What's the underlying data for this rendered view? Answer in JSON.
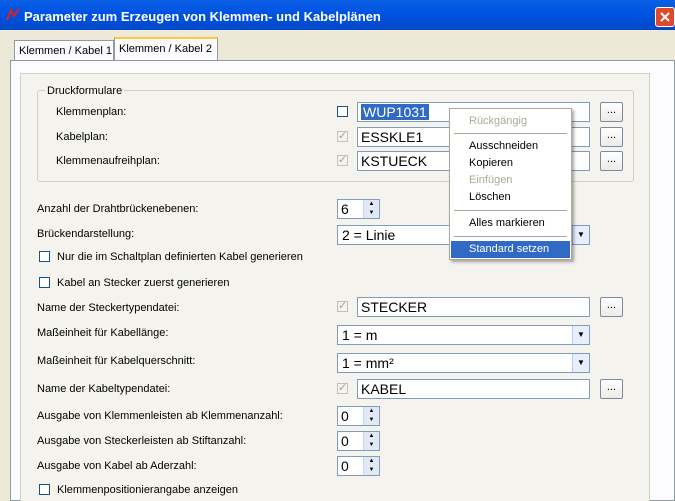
{
  "window": {
    "title": "Parameter zum Erzeugen von Klemmen- und Kabelplänen"
  },
  "tabs": [
    "Klemmen / Kabel 1",
    "Klemmen / Kabel 2"
  ],
  "group": {
    "title": "Druckformulare",
    "rows": [
      {
        "label": "Klemmenplan:",
        "value": "WUP1031",
        "checked": false
      },
      {
        "label": "Kabelplan:",
        "value": "ESSKLE1",
        "checked": true
      },
      {
        "label": "Klemmenaufreihplan:",
        "value": "KSTUECK",
        "checked": true
      }
    ]
  },
  "fields": {
    "drahtbrueckenebenen": {
      "label": "Anzahl der Drahtbrückenebenen:",
      "value": "6"
    },
    "brueckendarstellung": {
      "label": "Brückendarstellung:",
      "value": "2 = Linie"
    },
    "nur_schaltplan": "Nur die im Schaltplan definierten Kabel generieren",
    "kabel_stecker": "Kabel an Stecker zuerst generieren",
    "steckertypendatei": {
      "label": "Name der Steckertypendatei:",
      "value": "STECKER"
    },
    "einheit_laenge": {
      "label": "Maßeinheit für Kabellänge:",
      "value": "1 = m"
    },
    "einheit_querschnitt": {
      "label": "Maßeinheit für Kabelquerschnitt:",
      "value": "1 = mm²"
    },
    "kabeltypendatei": {
      "label": "Name der Kabeltypendatei:",
      "value": "KABEL"
    },
    "klemmenleisten": {
      "label": "Ausgabe von Klemmenleisten ab Klemmenanzahl:",
      "value": "0"
    },
    "steckerleisten": {
      "label": "Ausgabe von Steckerleisten ab Stiftanzahl:",
      "value": "0"
    },
    "kabel_aderzahl": {
      "label": "Ausgabe von Kabel ab Aderzahl:",
      "value": "0"
    },
    "klemmenposition": "Klemmenpositionierangabe anzeigen"
  },
  "browse_label": "...",
  "context_menu": {
    "items": [
      "Rückgängig",
      "Ausschneiden",
      "Kopieren",
      "Einfügen",
      "Löschen",
      "Alles markieren",
      "Standard setzen"
    ]
  }
}
